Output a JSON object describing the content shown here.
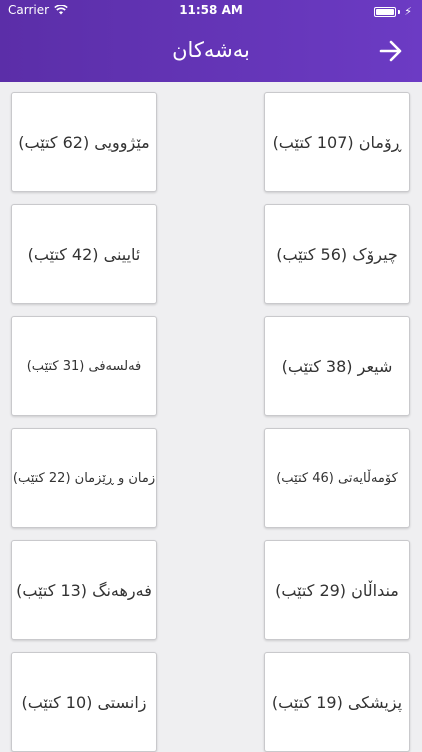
{
  "status": {
    "carrier": "Carrier",
    "time": "11:58 AM"
  },
  "header": {
    "title": "بەشەکان",
    "back_icon": "arrow-right-icon"
  },
  "categories": [
    {
      "label": "ڕۆمان (107 کتێب)"
    },
    {
      "label": "مێژوویی (62 کتێب)"
    },
    {
      "label": "چیرۆک (56 کتێب)"
    },
    {
      "label": "ئایینی (42 کتێب)"
    },
    {
      "label": "شیعر (38 کتێب)"
    },
    {
      "label": "فەلسەفی (31 کتێب)"
    },
    {
      "label": "کۆمەڵایەتی (46 کتێب)"
    },
    {
      "label": "زمان و ڕێزمان (22 کتێب)"
    },
    {
      "label": "منداڵان (29 کتێب)"
    },
    {
      "label": "فەرهەنگ (13 کتێب)"
    },
    {
      "label": "پزیشکی (19 کتێب)"
    },
    {
      "label": "زانستی (10 کتێب)"
    }
  ]
}
